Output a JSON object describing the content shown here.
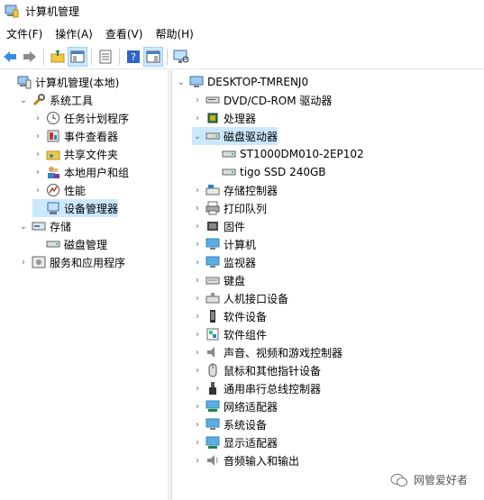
{
  "window": {
    "title": "计算机管理"
  },
  "menu": [
    "文件(F)",
    "操作(A)",
    "查看(V)",
    "帮助(H)"
  ],
  "left_tree": [
    {
      "label": "计算机管理(本地)",
      "indent": 0,
      "toggle": "",
      "icon": "computer-management-icon"
    },
    {
      "label": "系统工具",
      "indent": 1,
      "toggle": "open",
      "icon": "tools-icon"
    },
    {
      "label": "任务计划程序",
      "indent": 2,
      "toggle": "closed",
      "icon": "clock-icon"
    },
    {
      "label": "事件查看器",
      "indent": 2,
      "toggle": "closed",
      "icon": "event-viewer-icon"
    },
    {
      "label": "共享文件夹",
      "indent": 2,
      "toggle": "closed",
      "icon": "shared-folder-icon"
    },
    {
      "label": "本地用户和组",
      "indent": 2,
      "toggle": "closed",
      "icon": "users-icon"
    },
    {
      "label": "性能",
      "indent": 2,
      "toggle": "closed",
      "icon": "performance-icon"
    },
    {
      "label": "设备管理器",
      "indent": 2,
      "toggle": "",
      "icon": "device-manager-icon",
      "selected": true
    },
    {
      "label": "存储",
      "indent": 1,
      "toggle": "open",
      "icon": "storage-icon"
    },
    {
      "label": "磁盘管理",
      "indent": 2,
      "toggle": "",
      "icon": "disk-management-icon"
    },
    {
      "label": "服务和应用程序",
      "indent": 1,
      "toggle": "closed",
      "icon": "services-icon"
    }
  ],
  "right_tree": [
    {
      "label": "DESKTOP-TMRENJ0",
      "indent": 0,
      "toggle": "open",
      "icon": "computer-icon"
    },
    {
      "label": "DVD/CD-ROM 驱动器",
      "indent": 1,
      "toggle": "closed",
      "icon": "dvd-icon"
    },
    {
      "label": "处理器",
      "indent": 1,
      "toggle": "closed",
      "icon": "processor-icon"
    },
    {
      "label": "磁盘驱动器",
      "indent": 1,
      "toggle": "open",
      "icon": "disk-drive-icon",
      "selected": true
    },
    {
      "label": "ST1000DM010-2EP102",
      "indent": 2,
      "toggle": "",
      "icon": "disk-drive-icon"
    },
    {
      "label": "tigo SSD 240GB",
      "indent": 2,
      "toggle": "",
      "icon": "disk-drive-icon"
    },
    {
      "label": "存储控制器",
      "indent": 1,
      "toggle": "closed",
      "icon": "storage-controller-icon"
    },
    {
      "label": "打印队列",
      "indent": 1,
      "toggle": "closed",
      "icon": "printer-icon"
    },
    {
      "label": "固件",
      "indent": 1,
      "toggle": "closed",
      "icon": "firmware-icon"
    },
    {
      "label": "计算机",
      "indent": 1,
      "toggle": "closed",
      "icon": "monitor-computer-icon"
    },
    {
      "label": "监视器",
      "indent": 1,
      "toggle": "closed",
      "icon": "monitor-icon"
    },
    {
      "label": "键盘",
      "indent": 1,
      "toggle": "closed",
      "icon": "keyboard-icon"
    },
    {
      "label": "人机接口设备",
      "indent": 1,
      "toggle": "closed",
      "icon": "hid-icon"
    },
    {
      "label": "软件设备",
      "indent": 1,
      "toggle": "closed",
      "icon": "software-device-icon"
    },
    {
      "label": "软件组件",
      "indent": 1,
      "toggle": "closed",
      "icon": "software-component-icon"
    },
    {
      "label": "声音、视频和游戏控制器",
      "indent": 1,
      "toggle": "closed",
      "icon": "speaker-icon"
    },
    {
      "label": "鼠标和其他指针设备",
      "indent": 1,
      "toggle": "closed",
      "icon": "mouse-icon"
    },
    {
      "label": "通用串行总线控制器",
      "indent": 1,
      "toggle": "closed",
      "icon": "usb-icon"
    },
    {
      "label": "网络适配器",
      "indent": 1,
      "toggle": "closed",
      "icon": "network-adapter-icon"
    },
    {
      "label": "系统设备",
      "indent": 1,
      "toggle": "closed",
      "icon": "system-device-icon"
    },
    {
      "label": "显示适配器",
      "indent": 1,
      "toggle": "closed",
      "icon": "display-adapter-icon"
    },
    {
      "label": "音频输入和输出",
      "indent": 1,
      "toggle": "closed",
      "icon": "audio-io-icon"
    }
  ],
  "watermark": {
    "text": "网管爱好者"
  }
}
